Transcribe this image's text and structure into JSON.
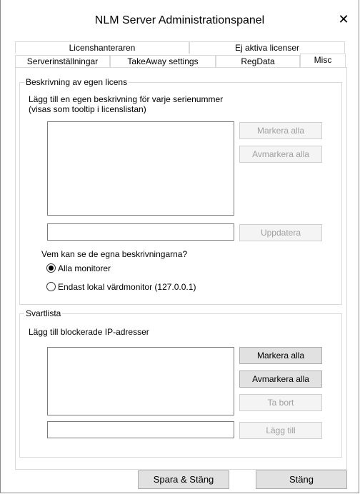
{
  "window": {
    "title": "NLM Server Administrationspanel",
    "close_glyph": "✕"
  },
  "tabs": {
    "row1": [
      "Licenshanteraren",
      "Ej aktiva licenser"
    ],
    "row2": [
      "Serverinställningar",
      "TakeAway settings",
      "RegData",
      "Misc"
    ],
    "active": "Misc"
  },
  "description": {
    "group_label": "Beskrivning av egen licens",
    "hint_line1": "Lägg till en egen beskrivning för varje serienummer",
    "hint_line2": "(visas som tooltip i licenslistan)",
    "select_all": "Markera alla",
    "deselect_all": "Avmarkera alla",
    "input_value": "",
    "update": "Uppdatera",
    "visibility_question": "Vem kan se de egna beskrivningarna?",
    "option_all": "Alla monitorer",
    "option_local": "Endast lokal värdmonitor (127.0.0.1)",
    "selected_option": "Alla monitorer"
  },
  "blacklist": {
    "group_label": "Svartlista",
    "hint": "Lägg till blockerade IP-adresser",
    "select_all": "Markera alla",
    "deselect_all": "Avmarkera alla",
    "remove": "Ta bort",
    "input_value": "",
    "add": "Lägg till"
  },
  "footer": {
    "save_close": "Spara & Stäng",
    "close": "Stäng"
  }
}
